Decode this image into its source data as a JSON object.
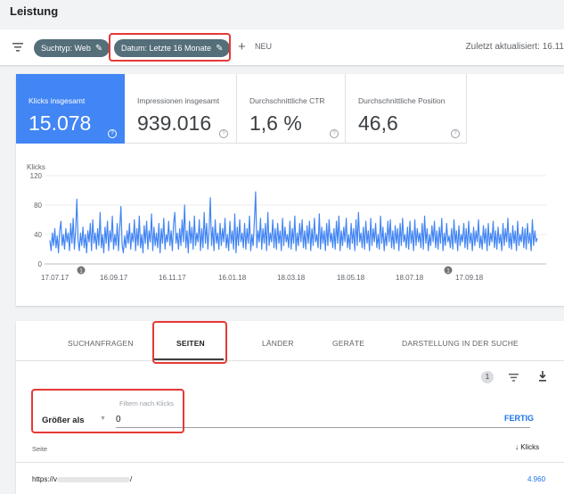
{
  "header": {
    "title": "Leistung"
  },
  "toolbar": {
    "filter_icon": "filter-list-icon",
    "chip_search_type": "Suchtyp: Web",
    "chip_date": "Datum: Letzte 16 Monate",
    "new_label": "NEU",
    "updated": "Zuletzt aktualisiert: 16.11"
  },
  "metrics": [
    {
      "label": "Klicks insgesamt",
      "value": "15.078"
    },
    {
      "label": "Impressionen insgesamt",
      "value": "939.016"
    },
    {
      "label": "Durchschnittliche CTR",
      "value": "1,6 %"
    },
    {
      "label": "Durchschnittliche Position",
      "value": "46,6"
    }
  ],
  "colors": {
    "accent": "#4285f4",
    "highlight_box": "#e53935",
    "chip": "#546e7a",
    "link": "#1a73e8"
  },
  "chart_data": {
    "type": "line",
    "ylabel": "Klicks",
    "ylim": [
      0,
      120
    ],
    "yticks": [
      0,
      40,
      80,
      120
    ],
    "xticks": [
      "17.07.17",
      "16.09.17",
      "16.11.17",
      "16.01.18",
      "18.03.18",
      "18.05.18",
      "18.07.18",
      "17.09.18"
    ],
    "annotation_markers": [
      "1",
      "1"
    ],
    "series": [
      {
        "values": [
          32,
          18,
          42,
          25,
          48,
          22,
          38,
          15,
          45,
          58,
          25,
          40,
          20,
          48,
          30,
          42,
          18,
          55,
          28,
          62,
          20,
          45,
          88,
          32,
          18,
          42,
          25,
          50,
          22,
          40,
          15,
          45,
          30,
          55,
          18,
          60,
          28,
          42,
          20,
          48,
          25,
          70,
          22,
          40,
          15,
          50,
          28,
          58,
          18,
          45,
          30,
          65,
          20,
          40,
          25,
          55,
          18,
          48,
          78,
          25,
          15,
          38,
          22,
          45,
          28,
          55,
          20,
          42,
          30,
          60,
          18,
          48,
          25,
          65,
          22,
          40,
          15,
          52,
          28,
          58,
          20,
          45,
          30,
          68,
          18,
          50,
          25,
          42,
          22,
          55,
          15,
          48,
          28,
          62,
          20,
          40,
          30,
          58,
          25,
          45,
          18,
          55,
          70,
          28,
          42,
          20,
          48,
          25,
          60,
          30,
          80,
          22,
          45,
          15,
          58,
          28,
          50,
          20,
          65,
          25,
          42,
          30,
          60,
          18,
          48,
          22,
          70,
          28,
          55,
          20,
          45,
          90,
          25,
          50,
          18,
          60,
          28,
          42,
          20,
          55,
          25,
          48,
          30,
          62,
          22,
          40,
          18,
          58,
          28,
          45,
          20,
          68,
          15,
          50,
          25,
          60,
          30,
          42,
          22,
          55,
          20,
          48,
          28,
          65,
          18,
          40,
          25,
          58,
          98,
          22,
          45,
          30,
          62,
          20,
          48,
          28,
          55,
          18,
          70,
          25,
          42,
          30,
          60,
          22,
          48,
          20,
          55,
          28,
          45,
          18,
          62,
          25,
          50,
          30,
          40,
          22,
          58,
          20,
          48,
          28,
          65,
          18,
          42,
          25,
          55,
          30,
          60,
          22,
          45,
          20,
          52,
          28,
          58,
          18,
          48,
          25,
          62,
          30,
          40,
          22,
          68,
          20,
          50,
          28,
          45,
          18,
          55,
          25,
          60,
          30,
          42,
          22,
          48,
          20,
          58,
          28,
          65,
          18,
          45,
          25,
          50,
          30,
          62,
          22,
          40,
          20,
          55,
          28,
          48,
          18,
          60,
          25,
          70,
          30,
          42,
          22,
          50,
          20,
          58,
          28,
          45,
          18,
          62,
          25,
          48,
          30,
          55,
          22,
          40,
          20,
          65,
          28,
          50,
          18,
          42,
          25,
          58,
          30,
          60,
          22,
          45,
          20,
          52,
          28,
          48,
          18,
          55,
          25,
          62,
          30,
          40,
          22,
          50,
          20,
          58,
          28,
          45,
          18,
          60,
          25,
          48,
          30,
          42,
          22,
          55,
          20,
          65,
          28,
          48,
          18,
          40,
          25,
          52,
          30,
          58,
          22,
          45,
          20,
          50,
          28,
          62,
          18,
          42,
          25,
          55,
          30,
          38,
          22,
          48,
          20,
          60,
          28,
          45,
          18,
          52,
          25,
          40,
          30,
          55,
          22,
          48,
          20,
          58,
          28,
          42,
          18,
          50,
          25,
          45,
          30,
          60,
          22,
          38,
          20,
          52,
          28,
          48,
          18,
          55,
          25,
          42,
          30,
          58,
          22,
          45,
          20,
          50,
          28,
          40,
          18,
          55,
          25,
          48,
          30,
          62,
          22,
          42,
          20,
          52,
          28,
          45,
          18,
          58,
          25,
          40,
          30,
          50,
          22,
          48,
          20,
          55,
          28,
          42,
          18,
          60,
          25,
          45,
          30,
          35
        ]
      }
    ]
  },
  "tabs": [
    "SUCHANFRAGEN",
    "SEITEN",
    "LÄNDER",
    "GERÄTE",
    "DARSTELLUNG IN DER SUCHE"
  ],
  "tools": {
    "filter_count": "1",
    "filter_icon": "filter-list-icon",
    "download_icon": "download-icon"
  },
  "filter": {
    "field_label": "Filtern nach Klicks",
    "operator": "Größer als",
    "value": "0",
    "done_label": "FERTIG"
  },
  "table": {
    "columns": [
      "Seite",
      "Klicks"
    ],
    "rows": [
      {
        "page": "https://v",
        "page_tail": "/",
        "clicks": "4.960"
      }
    ]
  }
}
